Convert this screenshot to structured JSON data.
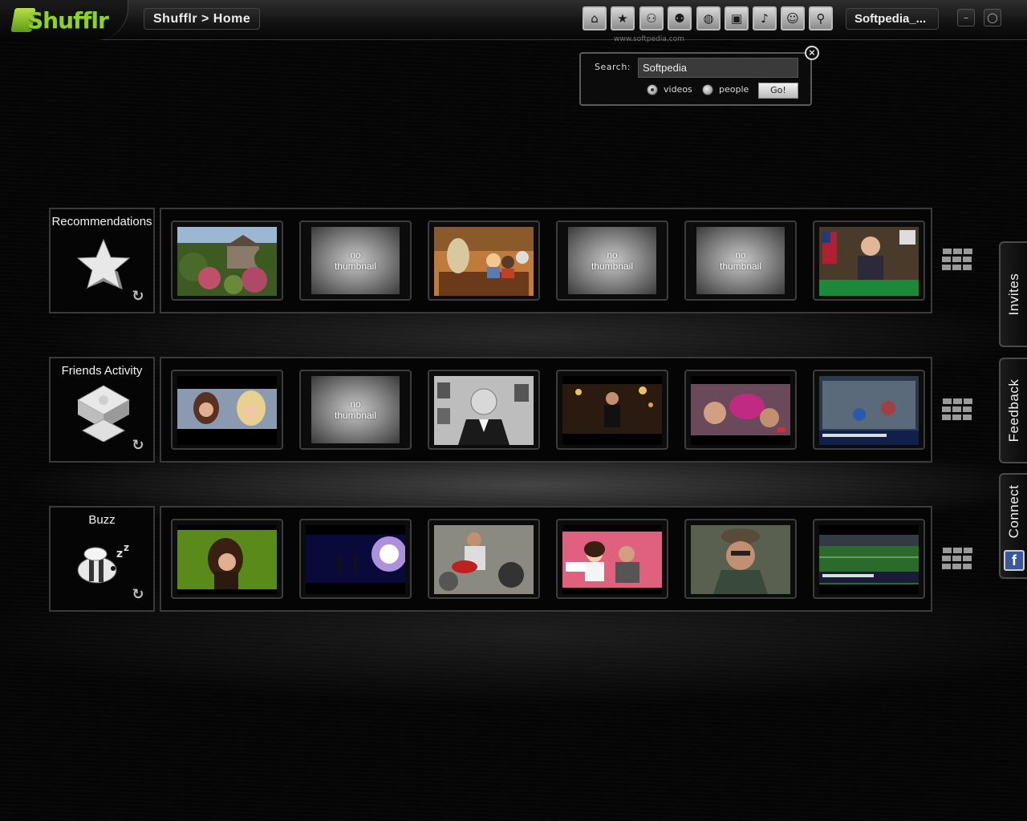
{
  "app": {
    "logo_text": "Shufflr",
    "breadcrumb": "Shufflr > Home",
    "user": "Softpedia_...",
    "watermark": "www.softpedia.com"
  },
  "nav_icons": [
    "home-icon",
    "star-icon",
    "friends-icon",
    "people-icon",
    "planet-icon",
    "tv-icon",
    "music-icon",
    "profile-icon",
    "search-icon"
  ],
  "window": {
    "minimize_label": "–",
    "close_label": "◯"
  },
  "search": {
    "label": "Search:",
    "value": "Softpedia",
    "options": [
      "videos",
      "people"
    ],
    "selected": "videos",
    "go_label": "Go!",
    "close_label": "×"
  },
  "rows": [
    {
      "title": "Recommendations",
      "icon": "star-icon",
      "thumbs": [
        {
          "type": "image",
          "desc": "garden"
        },
        {
          "type": "none",
          "text_line1": "no",
          "text_line2": "thumbnail"
        },
        {
          "type": "image",
          "desc": "cartoon-bar"
        },
        {
          "type": "none",
          "text_line1": "no",
          "text_line2": "thumbnail"
        },
        {
          "type": "none",
          "text_line1": "no",
          "text_line2": "thumbnail"
        },
        {
          "type": "image",
          "desc": "lecture"
        }
      ]
    },
    {
      "title": "Friends Activity",
      "icon": "puzzle-icon",
      "thumbs": [
        {
          "type": "image",
          "desc": "talk-show"
        },
        {
          "type": "none",
          "text_line1": "no",
          "text_line2": "thumbnail"
        },
        {
          "type": "image",
          "desc": "speech"
        },
        {
          "type": "image",
          "desc": "night-report"
        },
        {
          "type": "image",
          "desc": "party"
        },
        {
          "type": "image",
          "desc": "news"
        }
      ]
    },
    {
      "title": "Buzz",
      "icon": "bee-icon",
      "thumbs": [
        {
          "type": "image",
          "desc": "girl-field"
        },
        {
          "type": "image",
          "desc": "concert"
        },
        {
          "type": "image",
          "desc": "guitar"
        },
        {
          "type": "image",
          "desc": "tv-show"
        },
        {
          "type": "image",
          "desc": "man-hat"
        },
        {
          "type": "image",
          "desc": "stadium"
        }
      ]
    }
  ],
  "side_tabs": [
    "Invites",
    "Feedback",
    "Connect"
  ],
  "facebook_badge": "f"
}
